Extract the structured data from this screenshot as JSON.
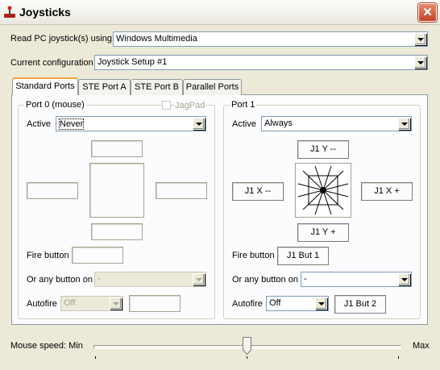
{
  "window": {
    "title": "Joysticks",
    "close_symbol": "✕"
  },
  "read_joystick": {
    "label": "Read PC joystick(s) using",
    "value": "Windows Multimedia"
  },
  "current_config": {
    "label": "Current configuration",
    "value": "Joystick Setup #1"
  },
  "tabs": [
    {
      "label": "Standard Ports",
      "selected": true
    },
    {
      "label": "STE Port A",
      "selected": false
    },
    {
      "label": "STE Port B",
      "selected": false
    },
    {
      "label": "Parallel Ports",
      "selected": false
    }
  ],
  "port0": {
    "title": "Port 0 (mouse)",
    "jagpad_label": "JagPad",
    "active_label": "Active",
    "active_value": "Never",
    "fire_label": "Fire button",
    "any_button_label": "Or any button on",
    "any_button_value": "-",
    "autofire_label": "Autofire",
    "autofire_value": "Off"
  },
  "port1": {
    "title": "Port 1",
    "active_label": "Active",
    "active_value": "Always",
    "y_up": "J1 Y --",
    "y_down": "J1 Y +",
    "x_left": "J1 X --",
    "x_right": "J1 X +",
    "fire_label": "Fire button",
    "fire_value": "J1 But 1",
    "any_button_label": "Or any button on",
    "any_button_value": "-",
    "autofire_label": "Autofire",
    "autofire_value": "Off",
    "autofire_button": "J1 But 2"
  },
  "mouse_speed": {
    "label": "Mouse speed: Min",
    "max_label": "Max",
    "level": 0.5
  },
  "colors": {
    "title_bg": "#fdfdfd",
    "dialog_bg": "#ECE9D8",
    "close_button": "#c1452a",
    "tab_highlight": "#f1a33a"
  },
  "icons": {
    "app": "joystick-icon",
    "close": "close-icon",
    "dropdown": "chevron-down-icon"
  }
}
